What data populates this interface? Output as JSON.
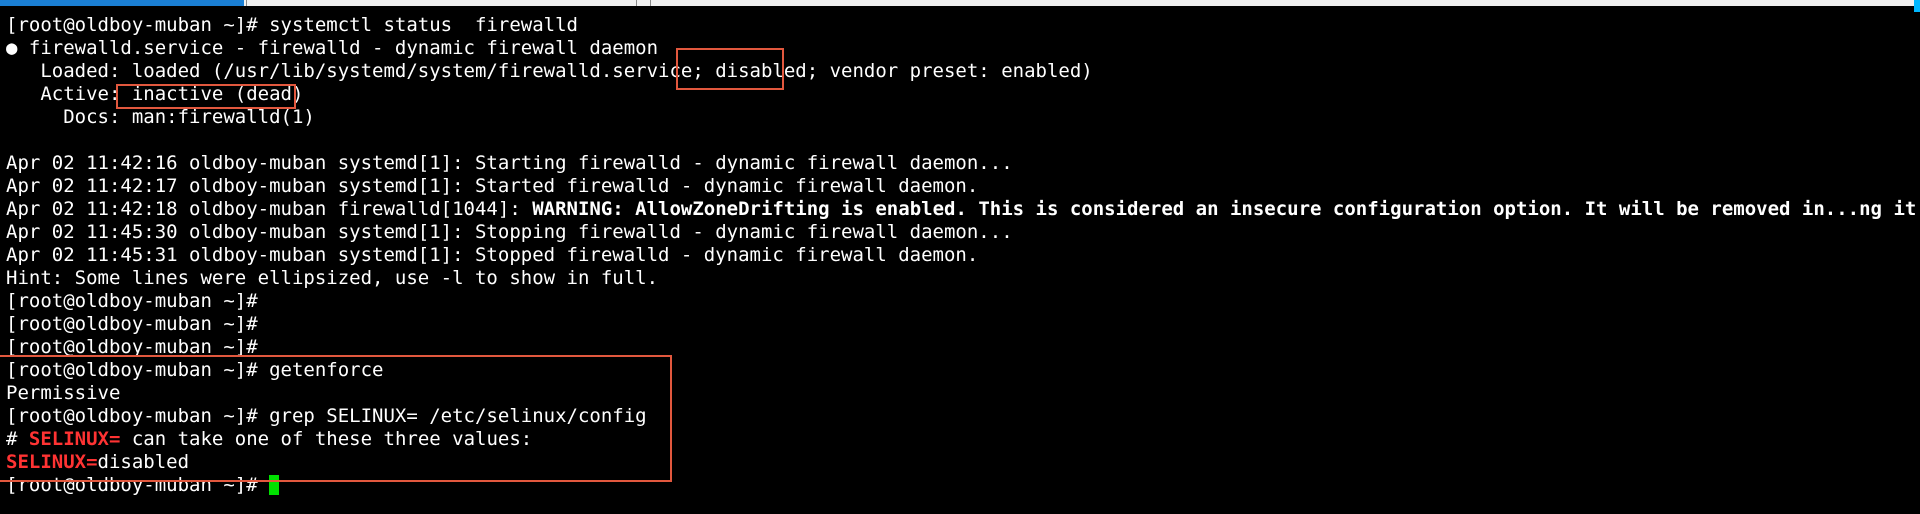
{
  "terminal": {
    "lines": [
      "[root@oldboy-muban ~]# systemctl status  firewalld",
      "● firewalld.service - firewalld - dynamic firewall daemon",
      "   Loaded: loaded (/usr/lib/systemd/system/firewalld.service; disabled; vendor preset: enabled)",
      "   Active: inactive (dead)",
      "     Docs: man:firewalld(1)",
      "",
      "Apr 02 11:42:16 oldboy-muban systemd[1]: Starting firewalld - dynamic firewall daemon...",
      "Apr 02 11:42:17 oldboy-muban systemd[1]: Started firewalld - dynamic firewall daemon.",
      "Apr 02 11:45:30 oldboy-muban systemd[1]: Stopping firewalld - dynamic firewall daemon...",
      "Apr 02 11:45:31 oldboy-muban systemd[1]: Stopped firewalld - dynamic firewall daemon.",
      "Hint: Some lines were ellipsized, use -l to show in full.",
      "[root@oldboy-muban ~]#",
      "[root@oldboy-muban ~]#",
      "[root@oldboy-muban ~]#",
      "[root@oldboy-muban ~]# getenforce",
      "Permissive",
      "[root@oldboy-muban ~]# grep SELINUX= /etc/selinux/config"
    ],
    "warning_line": {
      "prefix": "Apr 02 11:42:18 oldboy-muban firewalld[1044]: ",
      "bold": "WARNING: AllowZoneDrifting is enabled. This is considered an insecure configuration option. It will be removed in...ng it now."
    },
    "comment_line": {
      "hash": "# ",
      "match": "SELINUX=",
      "rest": " can take one of these three values:"
    },
    "selinux_line": {
      "match": "SELINUX=",
      "rest": "disabled"
    },
    "final_prompt": "[root@oldboy-muban ~]# "
  },
  "colors": {
    "background": "#000000",
    "text": "#ffffff",
    "grep_match": "#ff3333",
    "cursor": "#00e000",
    "highlight_box": "#e2583e",
    "active_tab": "#1a7fd4"
  }
}
